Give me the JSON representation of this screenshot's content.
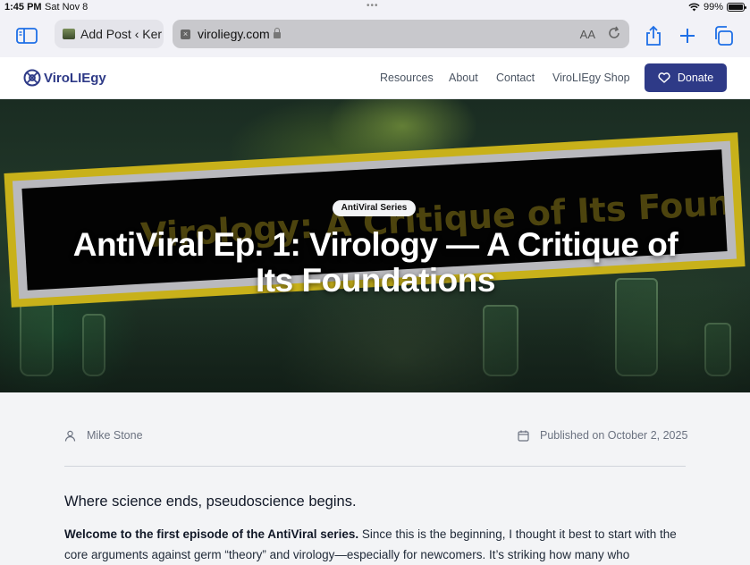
{
  "status_bar": {
    "time": "1:45 PM",
    "date": "Sat Nov 8",
    "battery": "99%",
    "battery_level": 0.99
  },
  "browser": {
    "tab_title": "Add Post ‹ Ker",
    "url": "viroliegy.com",
    "reader_label": "AA"
  },
  "site": {
    "logo_text": "ViroLIEgy",
    "nav": [
      "Resources",
      "About",
      "Contact",
      "ViroLIEgy Shop"
    ],
    "donate_label": "Donate",
    "brand_color": "#2e3a87"
  },
  "hero": {
    "badge": "AntiViral Series",
    "title": "AntiViral Ep. 1: Virology — A Critique of Its Foundations",
    "banner_ghost_text": "Virology: A Critique of Its Foundations"
  },
  "article": {
    "author": "Mike Stone",
    "published": "Published on October 2, 2025",
    "subheading": "Where science ends, pseudoscience begins.",
    "intro_bold": "Welcome to the first episode of the AntiViral series.",
    "intro_rest": " Since this is the beginning, I thought it best to start with the core arguments against germ “theory” and virology—especially for newcomers. It’s striking how many who"
  }
}
